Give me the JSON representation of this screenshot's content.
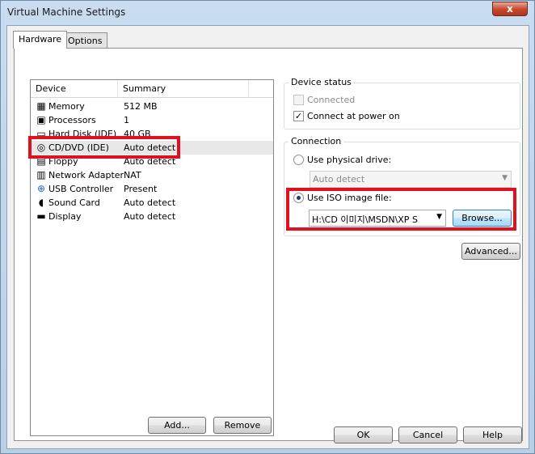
{
  "window": {
    "title": "Virtual Machine Settings",
    "close_glyph": "x"
  },
  "tabs": [
    {
      "label": "Hardware",
      "active": true
    },
    {
      "label": "Options",
      "active": false
    }
  ],
  "device_list": {
    "headers": {
      "device": "Device",
      "summary": "Summary"
    },
    "rows": [
      {
        "name": "Memory",
        "summary": "512 MB",
        "icon": "memory-icon"
      },
      {
        "name": "Processors",
        "summary": "1",
        "icon": "processor-icon"
      },
      {
        "name": "Hard Disk (IDE)",
        "summary": "40 GB",
        "icon": "hard-disk-icon"
      },
      {
        "name": "CD/DVD (IDE)",
        "summary": "Auto detect",
        "icon": "cd-dvd-icon",
        "selected": true
      },
      {
        "name": "Floppy",
        "summary": "Auto detect",
        "icon": "floppy-icon"
      },
      {
        "name": "Network Adapter",
        "summary": "NAT",
        "icon": "network-adapter-icon"
      },
      {
        "name": "USB Controller",
        "summary": "Present",
        "icon": "usb-icon"
      },
      {
        "name": "Sound Card",
        "summary": "Auto detect",
        "icon": "sound-card-icon"
      },
      {
        "name": "Display",
        "summary": "Auto detect",
        "icon": "display-icon"
      }
    ]
  },
  "list_buttons": {
    "add": "Add...",
    "remove": "Remove"
  },
  "device_status": {
    "label": "Device status",
    "connected": {
      "label": "Connected",
      "checked": false,
      "disabled": true
    },
    "connect_power_on": {
      "label": "Connect at power on",
      "checked": true
    }
  },
  "connection": {
    "label": "Connection",
    "physical_drive": {
      "label": "Use physical drive:",
      "selected": false,
      "value": "Auto detect"
    },
    "iso": {
      "label": "Use ISO image file:",
      "selected": true,
      "value": "H:\\CD 이미지\\MSDN\\XP S",
      "browse": "Browse..."
    }
  },
  "advanced_button": "Advanced...",
  "footer": {
    "ok": "OK",
    "cancel": "Cancel",
    "help": "Help"
  },
  "colors": {
    "highlight": "#e0101e",
    "selection": "#e8e8e8"
  }
}
